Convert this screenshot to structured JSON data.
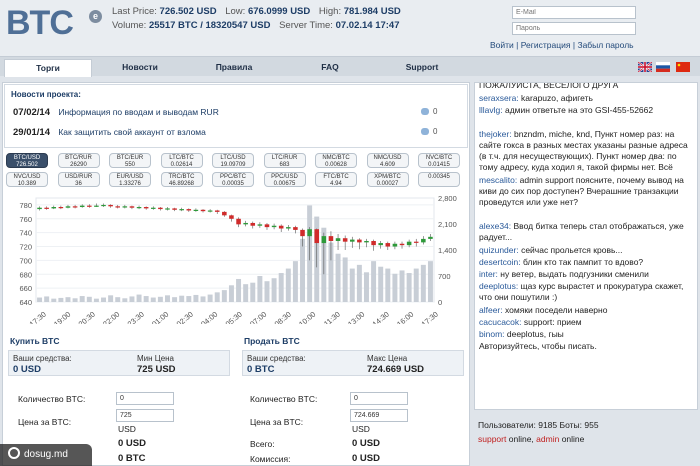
{
  "header": {
    "logo": "BTC",
    "logo_badge": "e",
    "last_price_label": "Last Price:",
    "last_price": "726.502 USD",
    "low_label": "Low:",
    "low": "676.0999 USD",
    "high_label": "High:",
    "high": "781.984 USD",
    "volume_label": "Volume:",
    "volume": "25517 BTC / 18320547 USD",
    "server_time_label": "Server Time:",
    "server_time": "07.02.14 17:47"
  },
  "login": {
    "email_placeholder": "E-Mail",
    "password_placeholder": "Пароль",
    "login_link": "Войти",
    "register_link": "Регистрация",
    "forgot_link": "Забыл пароль",
    "sep": "|"
  },
  "nav": {
    "tabs": [
      "Торги",
      "Новости",
      "Правила",
      "FAQ",
      "Support"
    ]
  },
  "news": {
    "title": "Новости проекта:",
    "items": [
      {
        "date": "07/02/14",
        "text": "Информация по вводам и выводам RUR",
        "count": "0"
      },
      {
        "date": "29/01/14",
        "text": "Как защитить свой аккаунт от взлома",
        "count": "0"
      }
    ]
  },
  "pairs": [
    {
      "name": "BTC/USD",
      "value": "726.502"
    },
    {
      "name": "BTC/RUR",
      "value": "26290"
    },
    {
      "name": "BTC/EUR",
      "value": "550"
    },
    {
      "name": "LTC/BTC",
      "value": "0.02614"
    },
    {
      "name": "LTC/USD",
      "value": "19.09709"
    },
    {
      "name": "LTC/RUR",
      "value": "683"
    },
    {
      "name": "NMC/BTC",
      "value": "0.00628"
    },
    {
      "name": "NMC/USD",
      "value": "4.609"
    },
    {
      "name": "NVC/BTC",
      "value": "0.01415"
    },
    {
      "name": "NVC/USD",
      "value": "10.389"
    },
    {
      "name": "USD/RUR",
      "value": "36"
    },
    {
      "name": "EUR/USD",
      "value": "1.33276"
    },
    {
      "name": "TRC/BTC",
      "value": "46.89268"
    },
    {
      "name": "PPC/BTC",
      "value": "0.00035"
    },
    {
      "name": "PPC/USD",
      "value": "0.00675"
    },
    {
      "name": "FTC/BTC",
      "value": "4.94"
    },
    {
      "name": "XPM/BTC",
      "value": "0.00027"
    },
    {
      "name": "",
      "value": "0.00345"
    }
  ],
  "chart_data": {
    "type": "candlestick",
    "x_ticks": [
      "17:30",
      "19:00",
      "20:30",
      "22:00",
      "23:30",
      "01:00",
      "02:30",
      "04:00",
      "05:30",
      "07:00",
      "08:30",
      "10:00",
      "11:30",
      "13:00",
      "14:30",
      "16:00",
      "17:30"
    ],
    "y_left_ticks": [
      "780",
      "760",
      "740",
      "720",
      "700",
      "680",
      "660",
      "640"
    ],
    "y_right_ticks": [
      "2,800",
      "2,100",
      "1,400",
      "700",
      "0"
    ],
    "ylim": [
      640,
      790
    ],
    "volume_lim": [
      0,
      2800
    ],
    "candles": [
      {
        "o": 774,
        "c": 776,
        "h": 778,
        "l": 772
      },
      {
        "o": 776,
        "c": 775,
        "h": 778,
        "l": 773
      },
      {
        "o": 775,
        "c": 777,
        "h": 779,
        "l": 774
      },
      {
        "o": 777,
        "c": 776,
        "h": 779,
        "l": 774
      },
      {
        "o": 776,
        "c": 778,
        "h": 780,
        "l": 775
      },
      {
        "o": 778,
        "c": 777,
        "h": 780,
        "l": 775
      },
      {
        "o": 777,
        "c": 779,
        "h": 781,
        "l": 776
      },
      {
        "o": 779,
        "c": 778,
        "h": 781,
        "l": 776
      },
      {
        "o": 778,
        "c": 779,
        "h": 782,
        "l": 777
      },
      {
        "o": 779,
        "c": 780,
        "h": 782,
        "l": 777
      },
      {
        "o": 780,
        "c": 778,
        "h": 781,
        "l": 776
      },
      {
        "o": 778,
        "c": 777,
        "h": 780,
        "l": 775
      },
      {
        "o": 777,
        "c": 778,
        "h": 780,
        "l": 775
      },
      {
        "o": 778,
        "c": 776,
        "h": 779,
        "l": 774
      },
      {
        "o": 776,
        "c": 777,
        "h": 779,
        "l": 774
      },
      {
        "o": 777,
        "c": 775,
        "h": 778,
        "l": 773
      },
      {
        "o": 775,
        "c": 776,
        "h": 778,
        "l": 773
      },
      {
        "o": 776,
        "c": 774,
        "h": 777,
        "l": 772
      },
      {
        "o": 774,
        "c": 775,
        "h": 777,
        "l": 772
      },
      {
        "o": 775,
        "c": 773,
        "h": 776,
        "l": 771
      },
      {
        "o": 773,
        "c": 774,
        "h": 776,
        "l": 771
      },
      {
        "o": 774,
        "c": 772,
        "h": 775,
        "l": 770
      },
      {
        "o": 772,
        "c": 773,
        "h": 775,
        "l": 770
      },
      {
        "o": 773,
        "c": 771,
        "h": 774,
        "l": 769
      },
      {
        "o": 771,
        "c": 772,
        "h": 774,
        "l": 769
      },
      {
        "o": 772,
        "c": 770,
        "h": 773,
        "l": 767
      },
      {
        "o": 770,
        "c": 765,
        "h": 771,
        "l": 763
      },
      {
        "o": 765,
        "c": 760,
        "h": 766,
        "l": 756
      },
      {
        "o": 760,
        "c": 752,
        "h": 762,
        "l": 748
      },
      {
        "o": 752,
        "c": 754,
        "h": 757,
        "l": 749
      },
      {
        "o": 754,
        "c": 750,
        "h": 756,
        "l": 746
      },
      {
        "o": 750,
        "c": 752,
        "h": 755,
        "l": 747
      },
      {
        "o": 752,
        "c": 748,
        "h": 754,
        "l": 744
      },
      {
        "o": 748,
        "c": 750,
        "h": 753,
        "l": 745
      },
      {
        "o": 750,
        "c": 746,
        "h": 752,
        "l": 741
      },
      {
        "o": 746,
        "c": 748,
        "h": 751,
        "l": 743
      },
      {
        "o": 748,
        "c": 744,
        "h": 750,
        "l": 739
      },
      {
        "o": 744,
        "c": 735,
        "h": 746,
        "l": 720
      },
      {
        "o": 735,
        "c": 745,
        "h": 748,
        "l": 700
      },
      {
        "o": 745,
        "c": 725,
        "h": 746,
        "l": 690
      },
      {
        "o": 725,
        "c": 735,
        "h": 740,
        "l": 680
      },
      {
        "o": 735,
        "c": 728,
        "h": 742,
        "l": 700
      },
      {
        "o": 728,
        "c": 732,
        "h": 738,
        "l": 715
      },
      {
        "o": 732,
        "c": 727,
        "h": 736,
        "l": 715
      },
      {
        "o": 727,
        "c": 730,
        "h": 734,
        "l": 718
      },
      {
        "o": 730,
        "c": 726,
        "h": 732,
        "l": 716
      },
      {
        "o": 726,
        "c": 728,
        "h": 731,
        "l": 719
      },
      {
        "o": 728,
        "c": 722,
        "h": 730,
        "l": 714
      },
      {
        "o": 722,
        "c": 725,
        "h": 728,
        "l": 717
      },
      {
        "o": 725,
        "c": 720,
        "h": 727,
        "l": 715
      },
      {
        "o": 720,
        "c": 724,
        "h": 727,
        "l": 716
      },
      {
        "o": 724,
        "c": 722,
        "h": 727,
        "l": 717
      },
      {
        "o": 722,
        "c": 727,
        "h": 730,
        "l": 719
      },
      {
        "o": 727,
        "c": 726,
        "h": 731,
        "l": 720
      },
      {
        "o": 726,
        "c": 731,
        "h": 735,
        "l": 723
      },
      {
        "o": 731,
        "c": 734,
        "h": 738,
        "l": 728
      }
    ],
    "volumes": [
      120,
      150,
      90,
      110,
      130,
      100,
      160,
      140,
      90,
      120,
      180,
      130,
      100,
      150,
      200,
      160,
      120,
      140,
      180,
      130,
      170,
      160,
      190,
      150,
      200,
      260,
      320,
      450,
      620,
      480,
      520,
      700,
      560,
      640,
      780,
      900,
      1100,
      1700,
      2600,
      2300,
      2000,
      1600,
      1300,
      1200,
      900,
      1000,
      800,
      1100,
      950,
      900,
      760,
      850,
      780,
      900,
      1000,
      1100
    ]
  },
  "buy": {
    "title": "Купить BTC",
    "funds_label": "Ваши средства:",
    "funds_value": "0 USD",
    "price_label": "Мин Цена",
    "price_value": "725 USD",
    "qty_label": "Количество BTC:",
    "qty_value": "0",
    "unit_price_label": "Цена за BTC:",
    "unit_price_value": "725",
    "unit_price_unit": "USD",
    "total_value": "0 USD",
    "fee_value": "0 BTC"
  },
  "sell": {
    "title": "Продать BTC",
    "funds_label": "Ваши средства:",
    "funds_value": "0 BTC",
    "price_label": "Макс Цена",
    "price_value": "724.669 USD",
    "qty_label": "Количество BTC:",
    "qty_value": "0",
    "unit_price_label": "Цена за BTC:",
    "unit_price_value": "724.669",
    "unit_price_unit": "USD",
    "total_label": "Всего:",
    "total_value": "0 USD",
    "fee_label": "Комиссия:",
    "fee_value": "0 USD"
  },
  "chat": [
    {
      "nick": "",
      "text": "ПОЖАЛУЙСТА, ВЕСЕЛОГО ДРУГА"
    },
    {
      "nick": "seraxsera:",
      "text": " karapuzo, афигеть"
    },
    {
      "nick": "lllavlg:",
      "text": " админ ответьте на это GSI-455-52662"
    },
    {
      "nick": "thejoker:",
      "text": " bnzndm, miche, knd, Пункт номер раз: на сайте гокса в разных местах указаны разные адреса (в т.ч. для несуществующих). Пункт номер два: по тому адресу, куда ходил я, такой фирмы нет. Всё"
    },
    {
      "nick": "mescalito:",
      "text": " admin support поясните, почему вывод на киви до сих пор доступен? Вчерашние транзакции проведутся или уже нет?"
    },
    {
      "nick": "alexe34:",
      "text": " Ввод битка теперь стал отображаться, уже радует..."
    },
    {
      "nick": "quizunder:",
      "text": " сейчас прольется кровь..."
    },
    {
      "nick": "desertcoin:",
      "text": " блин кто так пампит то вдово?"
    },
    {
      "nick": "inter:",
      "text": " ну ветер, выдать подгузники сменили"
    },
    {
      "nick": "deeplotus:",
      "text": " щаз курс вырастет и прокуратура скажет, что они пошутили :)"
    },
    {
      "nick": "alfeer:",
      "text": " хомяки поседели наверно"
    },
    {
      "nick": "cacucacok:",
      "text": " support: прием"
    },
    {
      "nick": "binom:",
      "text": " deeplotus, гыы"
    },
    {
      "nick": "",
      "text": "Авторизуйтесь, чтобы писать."
    }
  ],
  "users": {
    "users_label": "Пользователи:",
    "users_count": "9185",
    "bots_label": "Боты:",
    "bots_count": "955",
    "support": "support",
    "online1": "online,",
    "admin": "admin",
    "online2": "online"
  },
  "watermark": {
    "text": "dosug.md"
  },
  "colors": {
    "brand": "#4f6f96",
    "link": "#1d3d66",
    "candle_up": "#2e9a3a",
    "candle_down": "#d02b2b",
    "volume": "#c8ced6"
  }
}
